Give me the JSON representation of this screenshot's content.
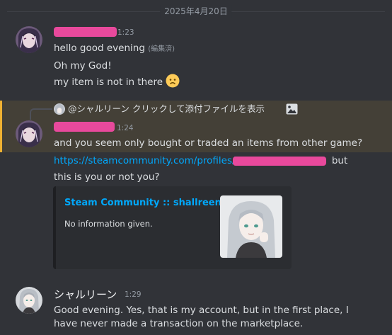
{
  "date_divider": "2025年4月20日",
  "messages": [
    {
      "time": "1:23",
      "lines": [
        "hello good evening",
        "Oh my God!",
        "my item is not in there"
      ],
      "edited": "(編集済)",
      "emoji": "frowning-face"
    },
    {
      "time": "1:24",
      "reply": {
        "text": "@シャルリーン クリックして添付ファイルを表示",
        "attachment_icon": "image-icon"
      },
      "lines": [
        "and you seem only bought or traded an items from other game?"
      ],
      "link_prefix": "https://steamcommunity.com/profiles/",
      "link_suffix": " but",
      "line_after_link": "this is you or not you?",
      "embed": {
        "title": "Steam Community :: shallreen",
        "description": "No information given."
      }
    },
    {
      "author": "シャルリーン",
      "time": "1:29",
      "lines": [
        "Good evening. Yes, that is my account, but in the first place, I",
        "have never made a transaction on the marketplace."
      ]
    }
  ],
  "colors": {
    "background": "#313338",
    "highlight": "#444037",
    "highlight_bar": "#f0b232",
    "link": "#00a8fc",
    "redaction": "#e8499c"
  }
}
